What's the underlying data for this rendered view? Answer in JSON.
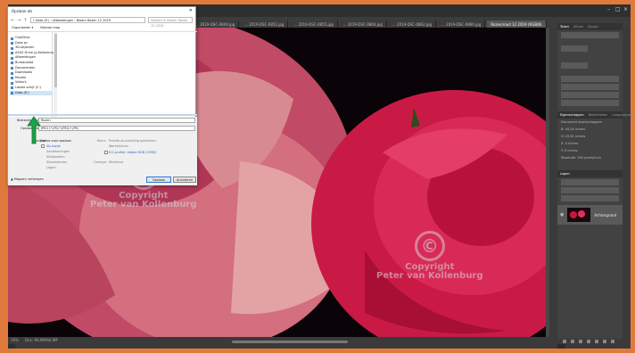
{
  "ps": {
    "tabs": [
      "... 2019-DSC-0849.jpg",
      "... 2019-DSC-0852.jpg",
      "... 2019-DSC-0855.jpg",
      "... 2019-DSC-0860.jpg",
      "... 2019-DSC-0862.jpg",
      "... 2019-DSC-0866.jpg",
      "Rozen/rood 12 2019 (RGB/8)"
    ],
    "status": {
      "zoom": "19%",
      "doc": "Doc: 66,9M/66,9M"
    },
    "panels": {
      "tabs_top": [
        "Teken",
        "Alinea",
        "Glyphs"
      ],
      "tabs_mid": [
        "Eigenschappen",
        "Bibliotheken",
        "Laagcomposities"
      ],
      "tabs_layers": [
        "Lagen"
      ],
      "layer_name": "Achtergrond",
      "props_label": "Document eigenschappen",
      "props_w": "B: 44,26 inches",
      "props_h": "H: 29,81 inches",
      "props_x": "X: 0 inches",
      "props_y": "Y: 0 inches",
      "props_res": "Resolutie: 300 pixels/inch"
    },
    "watermark": {
      "symbol": "©",
      "line1": "Copyright",
      "line2": "Peter van Kollenburg"
    }
  },
  "dialog": {
    "title": "Opslaan als",
    "close": "✕",
    "nav_back": "←",
    "nav_fwd": "→",
    "nav_up": "↑",
    "breadcrumb": "« Data (E:) › Afbeeldingen › Bloem Rozen 12 2019",
    "search_placeholder": "Zoeken in Bloem Rozen 12 2019",
    "organize": "Organiseren ▾",
    "new_folder": "Nieuwe map",
    "nav_items": [
      "OneDrive",
      "Deze pc",
      "3D-objecten",
      "ASUS Drive (p.Kollenburg)",
      "Afbeeldingen",
      "Bureaublad",
      "Documenten",
      "Downloads",
      "Muziek",
      "Video's",
      "Lokale schijf (C:)",
      "Data (E:)"
    ],
    "filename_label": "Bestandsnaam:",
    "filename_value": "Rozen",
    "type_label": "Opslaan als:",
    "type_value": "JPEG (*.JPG;*.JPEG;*.JPE)",
    "options_title": "Opslaan",
    "options_label": "Opties voor opslaan",
    "opt_copy": "Als kopie",
    "opt_notes": "Aantekeningen",
    "opt_alpha": "Alfakanalen",
    "opt_spot": "Steunkleuren",
    "opt_layers": "Lagen",
    "color_label": "Kleur:",
    "color_proof": "Proefdruk-instelling gebruiken:",
    "color_proof_val": "Werkkleuren",
    "color_icc": "ICC-profiel: Adobe RGB (1998)",
    "other_label": "Overige:",
    "thumb_label": "Miniatuur",
    "btn_save": "Opslaan",
    "btn_cancel": "Annuleren",
    "hide_folders": "▲ Mappen verbergen"
  }
}
